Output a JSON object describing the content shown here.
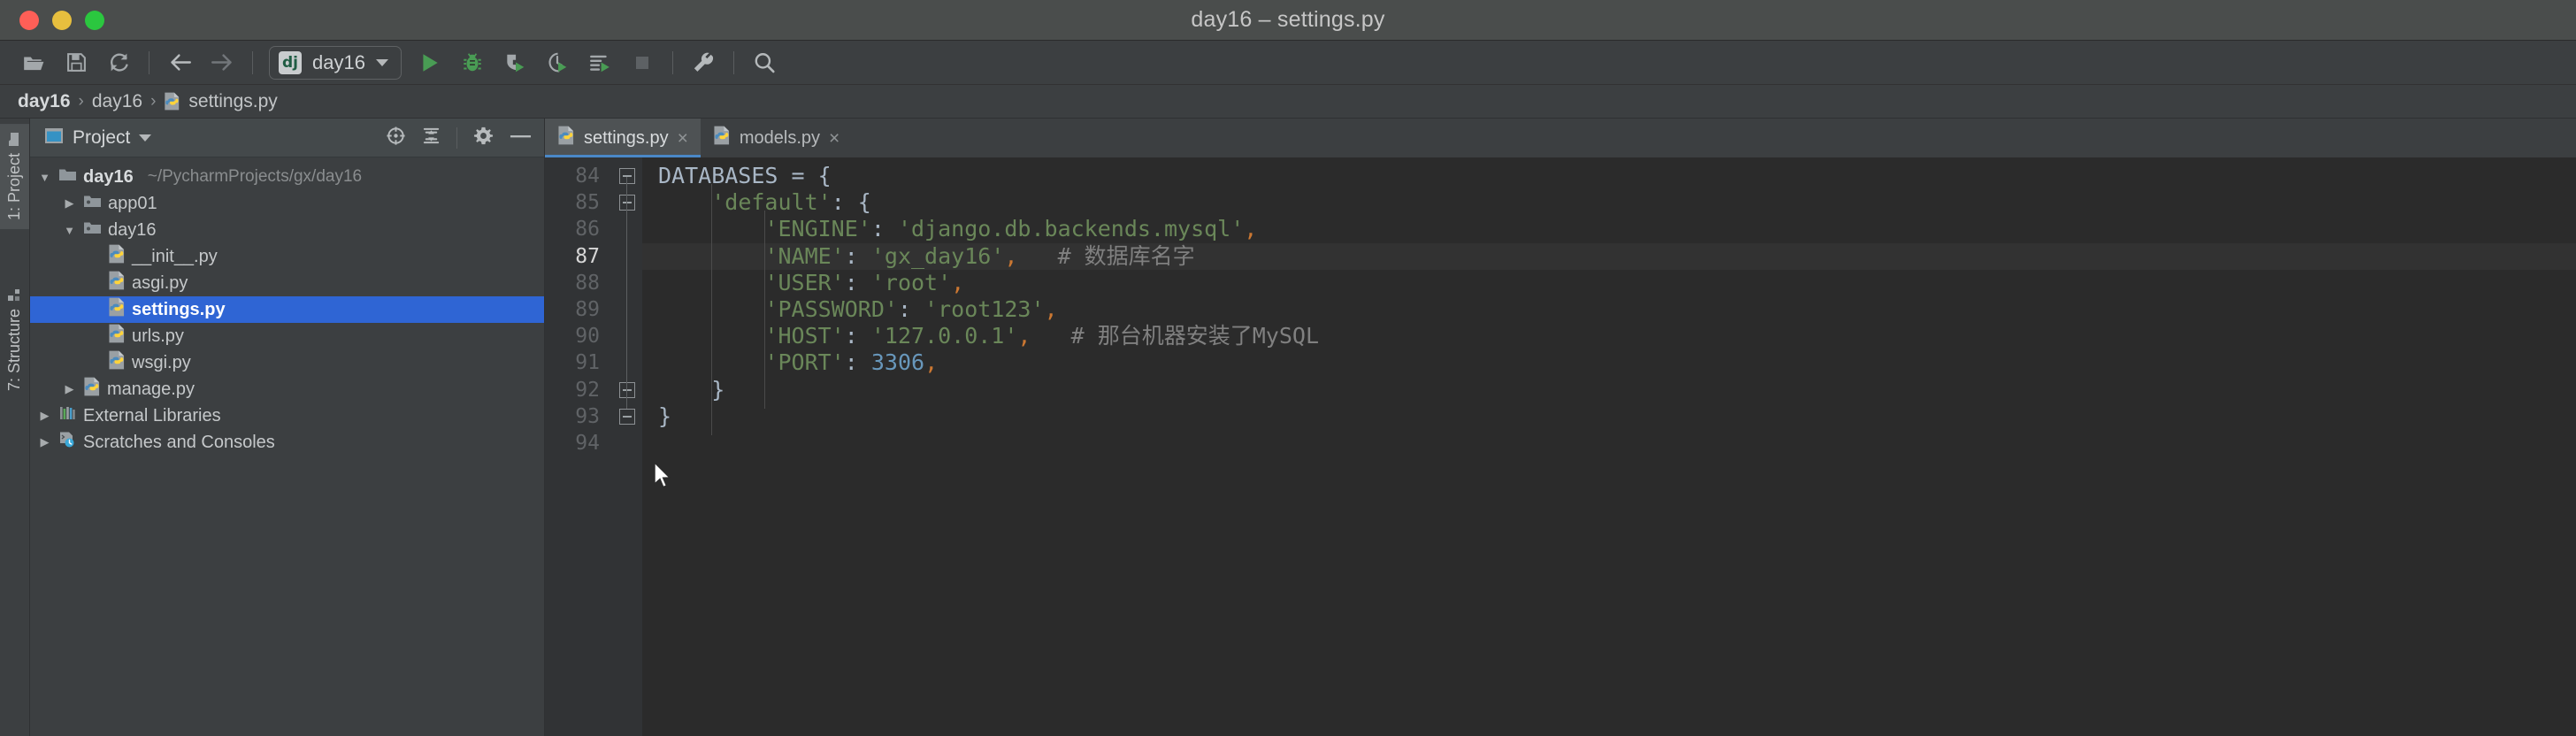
{
  "window": {
    "title": "day16 – settings.py",
    "traffic_lights": [
      "close",
      "minimize",
      "zoom"
    ]
  },
  "toolbar": {
    "buttons": [
      {
        "name": "open-folder",
        "icon": "folder-open-icon",
        "label": "Open"
      },
      {
        "name": "save-all",
        "icon": "save-icon",
        "label": "Save All"
      },
      {
        "name": "sync",
        "icon": "refresh-icon",
        "label": "Synchronize"
      },
      {
        "name": "back",
        "icon": "arrow-left-icon",
        "label": "Back"
      },
      {
        "name": "forward",
        "icon": "arrow-right-icon",
        "label": "Forward"
      }
    ],
    "run_config": {
      "badge": "dj",
      "name": "day16",
      "caret": "chevron-down-icon"
    },
    "run_buttons": [
      {
        "name": "run",
        "icon": "play-icon",
        "label": "Run"
      },
      {
        "name": "debug",
        "icon": "bug-icon",
        "label": "Debug"
      },
      {
        "name": "run-with-coverage",
        "icon": "coverage-icon",
        "label": "Run with Coverage"
      },
      {
        "name": "profile",
        "icon": "profiler-icon",
        "label": "Profile"
      },
      {
        "name": "run-with-console",
        "icon": "run-console-icon",
        "label": "Run with Console"
      },
      {
        "name": "stop",
        "icon": "stop-square-icon",
        "label": "Stop"
      }
    ],
    "right_buttons": [
      {
        "name": "settings",
        "icon": "wrench-icon",
        "label": "Settings"
      },
      {
        "name": "search-everywhere",
        "icon": "search-icon",
        "label": "Search Everywhere"
      }
    ]
  },
  "breadcrumb": {
    "items": [
      {
        "label": "day16",
        "bold": true,
        "icon": null
      },
      {
        "label": "day16",
        "bold": false,
        "icon": null
      },
      {
        "label": "settings.py",
        "bold": false,
        "icon": "python-file-icon"
      }
    ],
    "separator": "›"
  },
  "rail": {
    "items": [
      {
        "label": "1: Project",
        "icon": "folder-icon",
        "active": true
      },
      {
        "label": "7: Structure",
        "icon": "structure-icon",
        "active": false
      }
    ]
  },
  "project_panel": {
    "title": "Project",
    "title_icon": "project-window-icon",
    "title_caret": "chevron-down-icon",
    "head_icons": [
      {
        "name": "locate-file",
        "icon": "target-icon"
      },
      {
        "name": "collapse-all",
        "icon": "collapse-all-icon"
      },
      {
        "name": "settings",
        "icon": "gear-icon"
      },
      {
        "name": "hide-panel",
        "icon": "minus-icon"
      }
    ],
    "tree": [
      {
        "arrow": "expanded",
        "icon": "folder-icon",
        "label": "day16",
        "path": "~/PycharmProjects/gx/day16",
        "indent": 1,
        "bold": true,
        "selected": false
      },
      {
        "arrow": "collapsed",
        "icon": "module-folder-icon",
        "label": "app01",
        "path": "",
        "indent": 2,
        "bold": false,
        "selected": false
      },
      {
        "arrow": "expanded",
        "icon": "module-folder-icon",
        "label": "day16",
        "path": "",
        "indent": 2,
        "bold": false,
        "selected": false
      },
      {
        "arrow": "none",
        "icon": "python-file-icon",
        "label": "__init__.py",
        "path": "",
        "indent": 3,
        "bold": false,
        "selected": false
      },
      {
        "arrow": "none",
        "icon": "python-file-icon",
        "label": "asgi.py",
        "path": "",
        "indent": 3,
        "bold": false,
        "selected": false
      },
      {
        "arrow": "none",
        "icon": "python-file-icon",
        "label": "settings.py",
        "path": "",
        "indent": 3,
        "bold": false,
        "selected": true
      },
      {
        "arrow": "none",
        "icon": "python-file-icon",
        "label": "urls.py",
        "path": "",
        "indent": 3,
        "bold": false,
        "selected": false
      },
      {
        "arrow": "none",
        "icon": "python-file-icon",
        "label": "wsgi.py",
        "path": "",
        "indent": 3,
        "bold": false,
        "selected": false
      },
      {
        "arrow": "collapsed",
        "icon": "python-file-icon",
        "label": "manage.py",
        "path": "",
        "indent": 2,
        "bold": false,
        "selected": false
      },
      {
        "arrow": "collapsed",
        "icon": "libraries-icon",
        "label": "External Libraries",
        "path": "",
        "indent": 1,
        "bold": false,
        "selected": false
      },
      {
        "arrow": "collapsed",
        "icon": "scratches-icon",
        "label": "Scratches and Consoles",
        "path": "",
        "indent": 1,
        "bold": false,
        "selected": false
      }
    ]
  },
  "editor": {
    "tabs": [
      {
        "label": "settings.py",
        "icon": "python-file-icon",
        "active": true,
        "close": "×"
      },
      {
        "label": "models.py",
        "icon": "python-file-icon",
        "active": false,
        "close": "×"
      }
    ],
    "current_line": 87,
    "lines": [
      {
        "num": 84,
        "fold": "minus-down",
        "indent": 0,
        "tokens": [
          {
            "t": "DATABASES",
            "c": "def"
          },
          {
            "t": " = ",
            "c": "punc"
          },
          {
            "t": "{",
            "c": "punc"
          }
        ]
      },
      {
        "num": 85,
        "fold": "minus-down",
        "indent": 1,
        "tokens": [
          {
            "t": "    ",
            "c": "punc"
          },
          {
            "t": "'default'",
            "c": "str"
          },
          {
            "t": ": ",
            "c": "punc"
          },
          {
            "t": "{",
            "c": "punc"
          }
        ]
      },
      {
        "num": 86,
        "fold": "none",
        "indent": 2,
        "tokens": [
          {
            "t": "        ",
            "c": "punc"
          },
          {
            "t": "'ENGINE'",
            "c": "str"
          },
          {
            "t": ": ",
            "c": "punc"
          },
          {
            "t": "'django.db.backends.mysql'",
            "c": "str"
          },
          {
            "t": ",",
            "c": "comma"
          }
        ]
      },
      {
        "num": 87,
        "fold": "none",
        "indent": 2,
        "tokens": [
          {
            "t": "        ",
            "c": "punc"
          },
          {
            "t": "'NAME'",
            "c": "str"
          },
          {
            "t": ": ",
            "c": "punc"
          },
          {
            "t": "'gx_day16'",
            "c": "str"
          },
          {
            "t": ",",
            "c": "comma"
          },
          {
            "t": "   ",
            "c": "punc"
          },
          {
            "t": "# 数据库名字",
            "c": "comment"
          }
        ]
      },
      {
        "num": 88,
        "fold": "none",
        "indent": 2,
        "tokens": [
          {
            "t": "        ",
            "c": "punc"
          },
          {
            "t": "'USER'",
            "c": "str"
          },
          {
            "t": ": ",
            "c": "punc"
          },
          {
            "t": "'root'",
            "c": "str"
          },
          {
            "t": ",",
            "c": "comma"
          }
        ]
      },
      {
        "num": 89,
        "fold": "none",
        "indent": 2,
        "tokens": [
          {
            "t": "        ",
            "c": "punc"
          },
          {
            "t": "'PASSWORD'",
            "c": "str"
          },
          {
            "t": ": ",
            "c": "punc"
          },
          {
            "t": "'root123'",
            "c": "str"
          },
          {
            "t": ",",
            "c": "comma"
          }
        ]
      },
      {
        "num": 90,
        "fold": "none",
        "indent": 2,
        "tokens": [
          {
            "t": "        ",
            "c": "punc"
          },
          {
            "t": "'HOST'",
            "c": "str"
          },
          {
            "t": ": ",
            "c": "punc"
          },
          {
            "t": "'127.0.0.1'",
            "c": "str"
          },
          {
            "t": ",",
            "c": "comma"
          },
          {
            "t": "   ",
            "c": "punc"
          },
          {
            "t": "# 那台机器安装了MySQL",
            "c": "comment"
          }
        ]
      },
      {
        "num": 91,
        "fold": "none",
        "indent": 2,
        "tokens": [
          {
            "t": "        ",
            "c": "punc"
          },
          {
            "t": "'PORT'",
            "c": "str"
          },
          {
            "t": ": ",
            "c": "punc"
          },
          {
            "t": "3306",
            "c": "num"
          },
          {
            "t": ",",
            "c": "comma"
          }
        ]
      },
      {
        "num": 92,
        "fold": "minus-up",
        "indent": 1,
        "tokens": [
          {
            "t": "    ",
            "c": "punc"
          },
          {
            "t": "}",
            "c": "punc"
          }
        ]
      },
      {
        "num": 93,
        "fold": "minus-up",
        "indent": 0,
        "tokens": [
          {
            "t": "}",
            "c": "punc"
          }
        ]
      },
      {
        "num": 94,
        "fold": "none",
        "indent": 0,
        "tokens": []
      }
    ]
  },
  "colors": {
    "accent_selection": "#2f65d4",
    "editor_bg": "#2b2b2b",
    "gutter_bg": "#313335",
    "panel_bg": "#3c3f41",
    "string": "#6a8759",
    "number": "#6897bb",
    "comment": "#808080",
    "comma": "#cc7832",
    "text": "#a9b7c6",
    "run_green": "#499c54",
    "tab_underline": "#4a88c7"
  }
}
